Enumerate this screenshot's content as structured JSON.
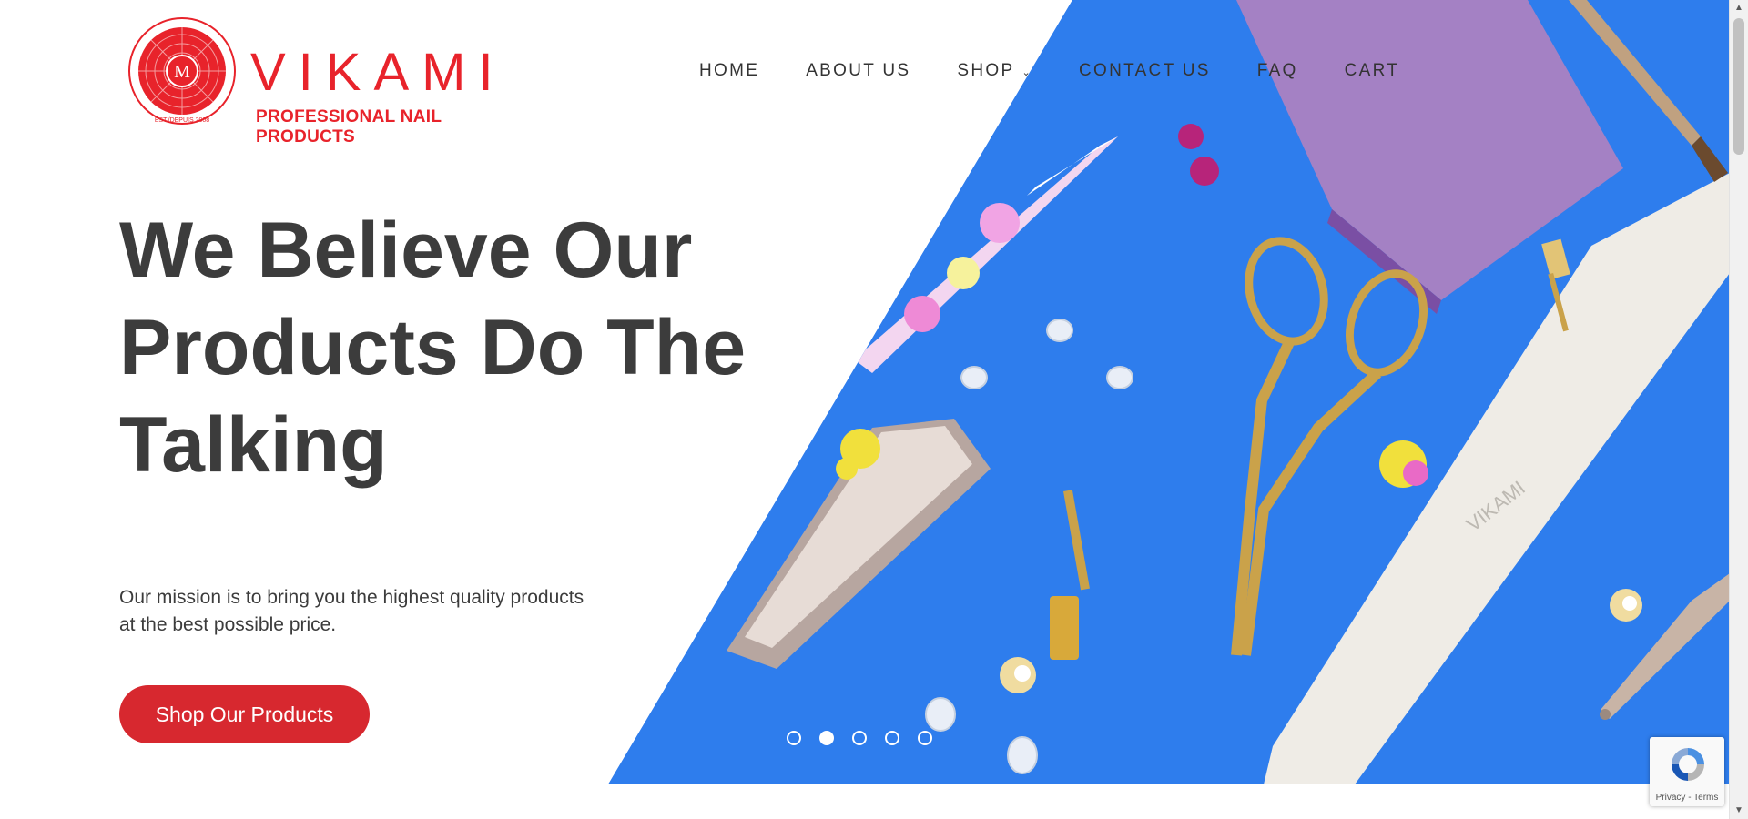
{
  "logo": {
    "brand": "VIKAMI",
    "tagline": "PROFESSIONAL NAIL PRODUCTS",
    "emblem_text": "EST./DEPUIS 2008",
    "colors": {
      "brand": "#e8232b"
    }
  },
  "nav": {
    "items": [
      {
        "label": "HOME"
      },
      {
        "label": "ABOUT US"
      },
      {
        "label": "SHOP",
        "has_dropdown": true
      },
      {
        "label": "CONTACT US"
      },
      {
        "label": "FAQ"
      },
      {
        "label": "CART"
      }
    ]
  },
  "hero": {
    "headline_line1": "We Believe Our",
    "headline_line2": "Products Do The",
    "headline_line3": "Talking",
    "mission": "Our mission is to bring you the highest quality products at the best possible price.",
    "cta_label": "Shop Our Products",
    "image_description_icon": "nail-tools-photo",
    "background_color": "#2e7ded",
    "cta_color": "#d7282f"
  },
  "slider": {
    "dots": 5,
    "active_index": 1
  },
  "recaptcha": {
    "links": "Privacy - Terms"
  }
}
